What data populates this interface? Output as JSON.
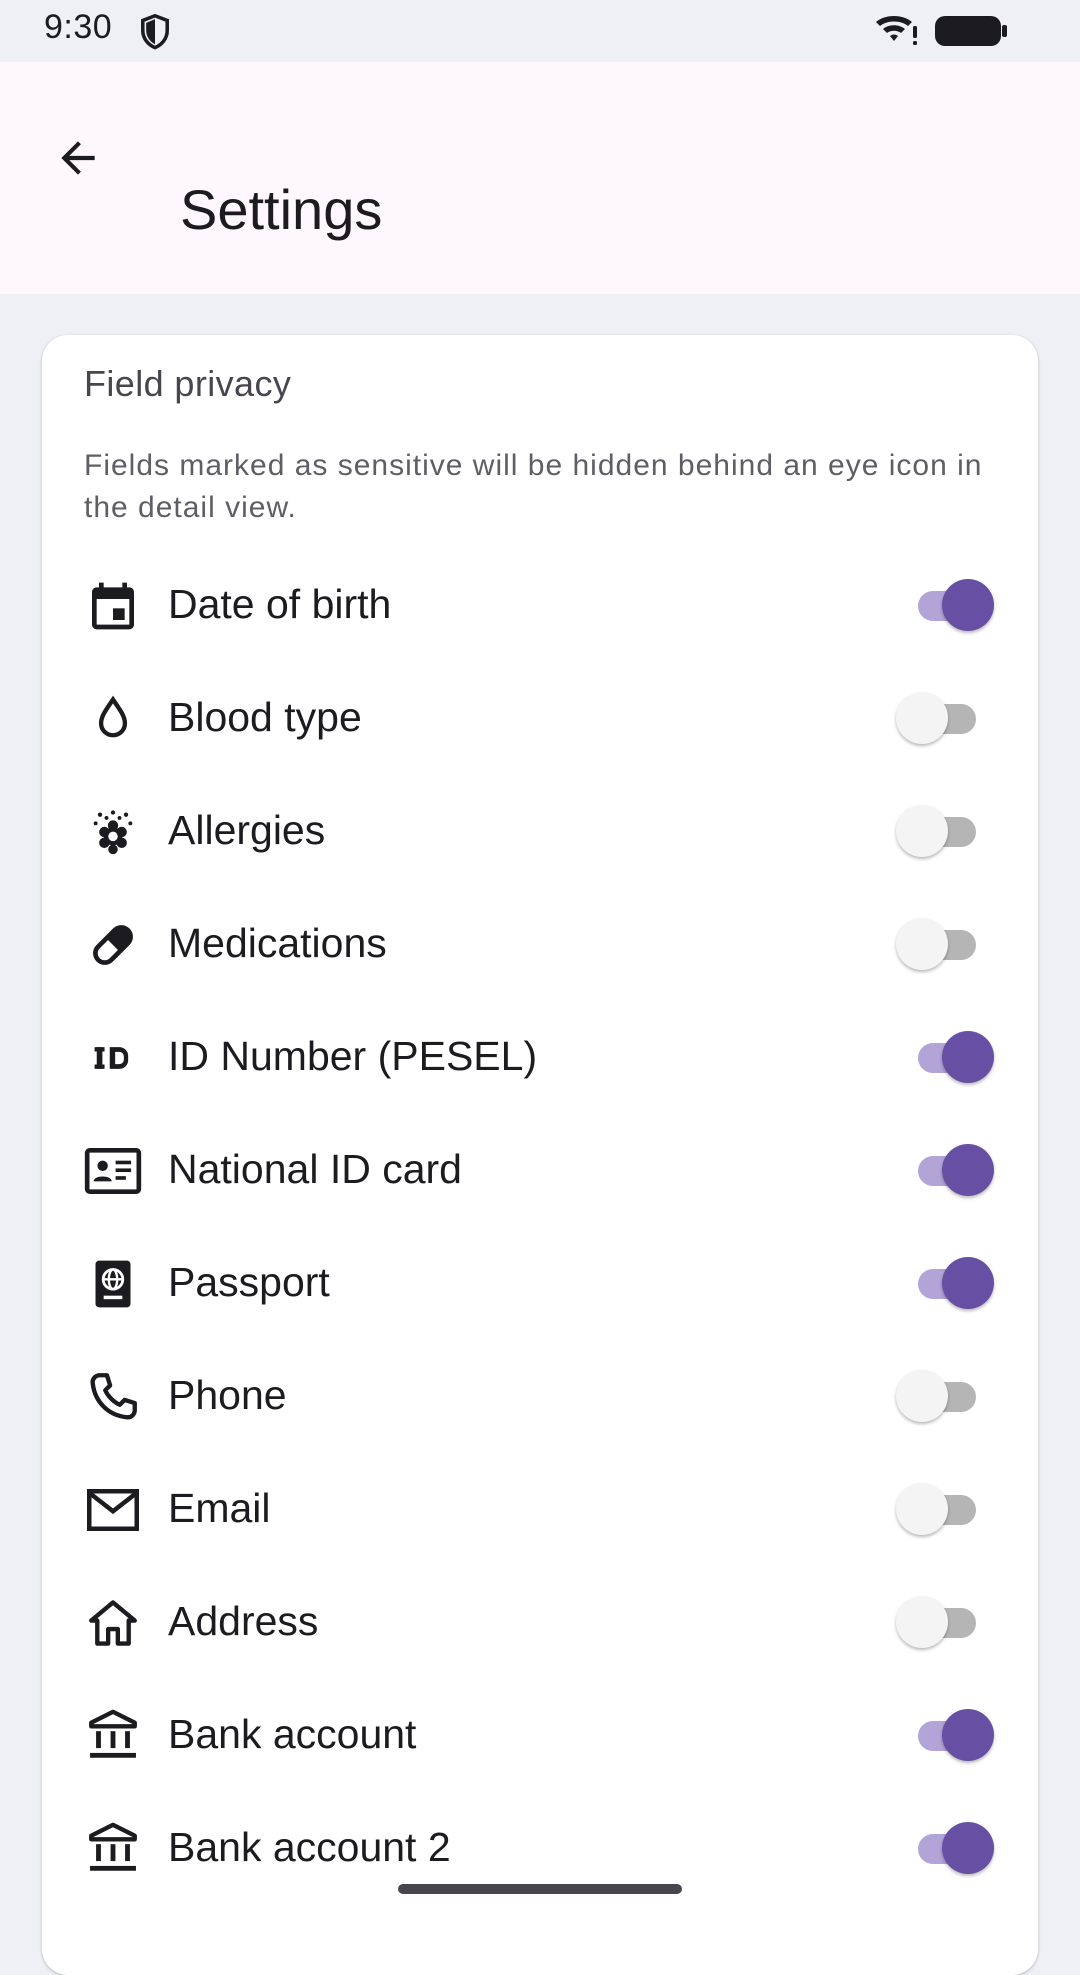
{
  "status": {
    "time": "9:30"
  },
  "header": {
    "title": "Settings"
  },
  "card": {
    "title": "Field privacy",
    "description": "Fields marked as sensitive will be hidden behind an eye icon in the detail view.",
    "items": [
      {
        "label": "Date of birth",
        "icon": "calendar-icon",
        "enabled": true
      },
      {
        "label": "Blood type",
        "icon": "water-drop-icon",
        "enabled": false
      },
      {
        "label": "Allergies",
        "icon": "allergy-icon",
        "enabled": false
      },
      {
        "label": "Medications",
        "icon": "medication-pill-icon",
        "enabled": false
      },
      {
        "label": "ID Number (PESEL)",
        "icon": "id-badge-icon",
        "enabled": true
      },
      {
        "label": "National ID card",
        "icon": "id-card-icon",
        "enabled": true
      },
      {
        "label": "Passport",
        "icon": "passport-icon",
        "enabled": true
      },
      {
        "label": "Phone",
        "icon": "phone-icon",
        "enabled": false
      },
      {
        "label": "Email",
        "icon": "email-icon",
        "enabled": false
      },
      {
        "label": "Address",
        "icon": "home-icon",
        "enabled": false
      },
      {
        "label": "Bank account",
        "icon": "bank-icon",
        "enabled": true
      },
      {
        "label": "Bank account 2",
        "icon": "bank-icon",
        "enabled": true
      }
    ]
  },
  "colors": {
    "accent": "#6750a4",
    "accent_track": "#b3a4d7",
    "off_track": "#b5b5b5",
    "off_thumb": "#f4f4f4"
  }
}
